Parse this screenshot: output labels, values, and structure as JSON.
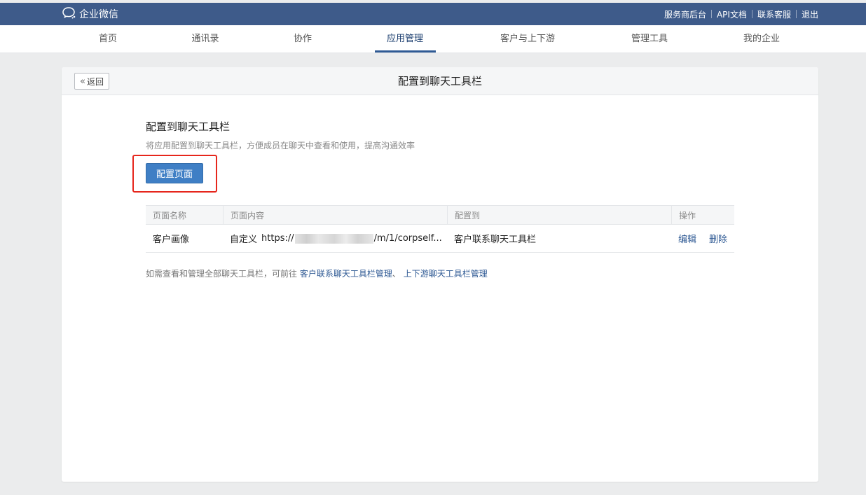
{
  "topbar": {
    "logo_text": "企业微信",
    "links": [
      "服务商后台",
      "API文档",
      "联系客服",
      "退出"
    ]
  },
  "nav": {
    "items": [
      "首页",
      "通讯录",
      "协作",
      "应用管理",
      "客户与上下游",
      "管理工具",
      "我的企业"
    ],
    "active": "应用管理"
  },
  "page": {
    "back_label": "返回",
    "title": "配置到聊天工具栏"
  },
  "section": {
    "title": "配置到聊天工具栏",
    "description": "将应用配置到聊天工具栏，方便成员在聊天中查看和使用，提高沟通效率",
    "button_label": "配置页面"
  },
  "table": {
    "headers": [
      "页面名称",
      "页面内容",
      "配置到",
      "操作"
    ],
    "rows": [
      {
        "name": "客户画像",
        "content_prefix": "自定义",
        "url_start": "https://",
        "url_end": "/m/1/corpself...",
        "target": "客户联系聊天工具栏",
        "actions": [
          "编辑",
          "删除"
        ]
      }
    ]
  },
  "footer": {
    "text": "如需查看和管理全部聊天工具栏，可前往",
    "link1": "客户联系聊天工具栏管理",
    "separator": "、",
    "link2": "上下游聊天工具栏管理"
  },
  "colors": {
    "topbar_bg": "#3e5b8a",
    "accent": "#3f7fc5",
    "highlight": "#e6261c"
  }
}
